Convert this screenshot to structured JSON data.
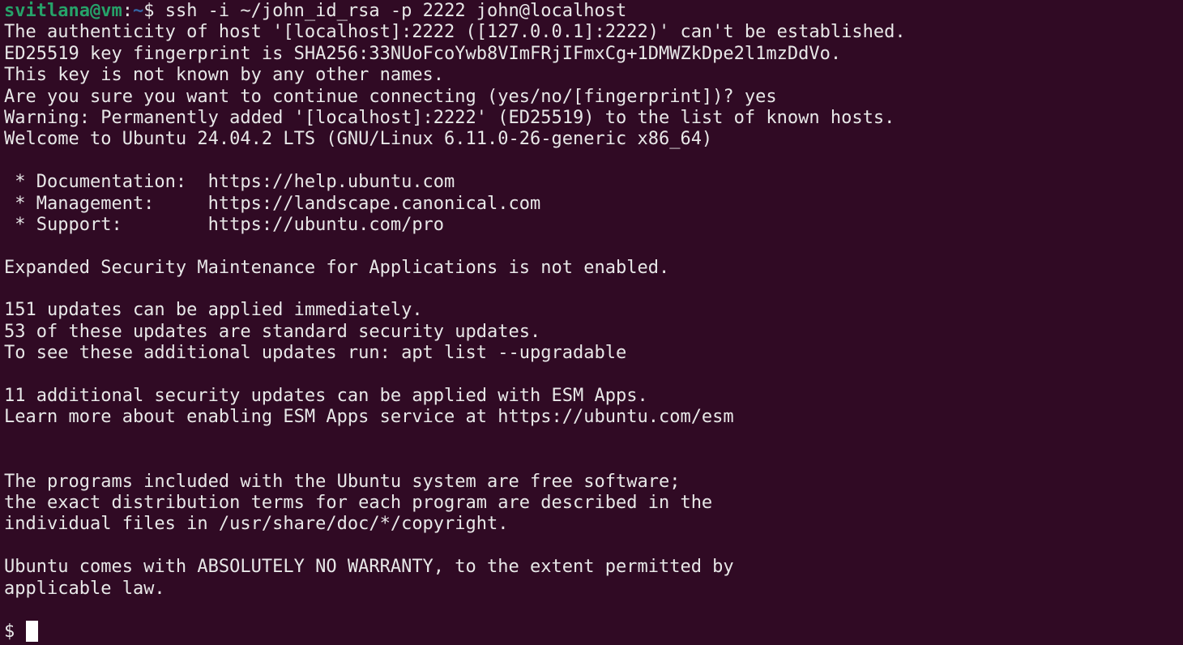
{
  "prompt": {
    "user_host": "svitlana@vm",
    "separator": ":",
    "path": "~",
    "symbol": "$",
    "command": " ssh -i ~/john_id_rsa -p 2222 john@localhost"
  },
  "output_lines": [
    "The authenticity of host '[localhost]:2222 ([127.0.0.1]:2222)' can't be established.",
    "ED25519 key fingerprint is SHA256:33NUoFcoYwb8VImFRjIFmxCg+1DMWZkDpe2l1mzDdVo.",
    "This key is not known by any other names.",
    "Are you sure you want to continue connecting (yes/no/[fingerprint])? yes",
    "Warning: Permanently added '[localhost]:2222' (ED25519) to the list of known hosts.",
    "Welcome to Ubuntu 24.04.2 LTS (GNU/Linux 6.11.0-26-generic x86_64)",
    "",
    " * Documentation:  https://help.ubuntu.com",
    " * Management:     https://landscape.canonical.com",
    " * Support:        https://ubuntu.com/pro",
    "",
    "Expanded Security Maintenance for Applications is not enabled.",
    "",
    "151 updates can be applied immediately.",
    "53 of these updates are standard security updates.",
    "To see these additional updates run: apt list --upgradable",
    "",
    "11 additional security updates can be applied with ESM Apps.",
    "Learn more about enabling ESM Apps service at https://ubuntu.com/esm",
    "",
    "",
    "The programs included with the Ubuntu system are free software;",
    "the exact distribution terms for each program are described in the",
    "individual files in /usr/share/doc/*/copyright.",
    "",
    "Ubuntu comes with ABSOLUTELY NO WARRANTY, to the extent permitted by",
    "applicable law.",
    ""
  ],
  "remote_prompt": "$ ",
  "colors": {
    "background": "#300a24",
    "text": "#e8e8e8",
    "user_host": "#26a269",
    "path": "#3465a4",
    "cursor": "#ffffff"
  }
}
